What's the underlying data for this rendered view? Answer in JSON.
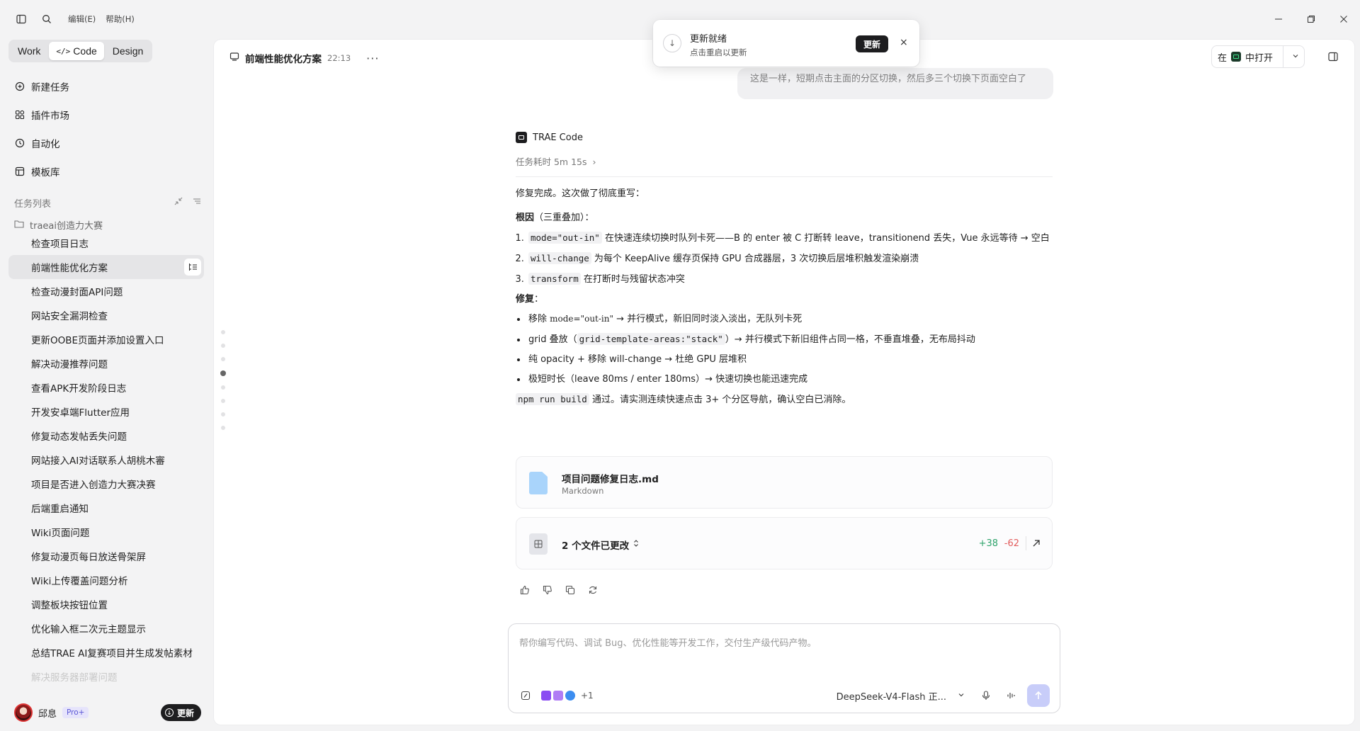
{
  "titlebar": {
    "menus": [
      "编辑(E)",
      "帮助(H)"
    ]
  },
  "sidebar": {
    "modes": [
      "Work",
      "Code",
      "Design"
    ],
    "active_mode": "Code",
    "nav": [
      {
        "label": "新建任务",
        "icon": "new-task-icon"
      },
      {
        "label": "插件市场",
        "icon": "plugin-market-icon"
      },
      {
        "label": "自动化",
        "icon": "automation-clock-icon"
      },
      {
        "label": "模板库",
        "icon": "template-icon"
      }
    ],
    "tasks_header": "任务列表",
    "folder": "traeai创造力大赛",
    "tasks": [
      "检查项目日志",
      "前端性能优化方案",
      "检查动漫封面API问题",
      "网站安全漏洞检查",
      "更新OOBE页面并添加设置入口",
      "解决动漫推荐问题",
      "查看APK开发阶段日志",
      "开发安卓端Flutter应用",
      "修复动态发帖丢失问题",
      "网站接入AI对话联系人胡桃木審",
      "项目是否进入创造力大赛决赛",
      "后端重启通知",
      "Wiki页面问题",
      "修复动漫页每日放送骨架屏",
      "Wiki上传覆盖问题分析",
      "调整板块按钮位置",
      "优化输入框二次元主题显示",
      "总结TRAE AI复赛项目并生成发帖素材",
      "解决服务器部署问题"
    ],
    "active_task_index": 1,
    "user": {
      "name": "邱息",
      "badge": "Pro+",
      "update_label": "更新"
    }
  },
  "header": {
    "title": "前端性能优化方案",
    "time": "22:13",
    "open_in_prefix": "在",
    "open_in_suffix": "中打开"
  },
  "toast": {
    "title": "更新就绪",
    "subtitle": "点击重启以更新",
    "button": "更新"
  },
  "message": {
    "prev_bubble": "这是一样，短期点击主面的分区切换，然后多三个切换下页面空白了",
    "agent": "TRAE Code",
    "duration": "任务耗时 5m 15s",
    "intro": "修复完成。这次做了彻底重写：",
    "cause_title_bold": "根因",
    "cause_title_rest": "（三重叠加）：",
    "causes": [
      {
        "code": "mode=\"out-in\"",
        "text": " 在快速连续切换时队列卡死——B 的 enter 被 C 打断转 leave，transitionend 丢失，Vue 永远等待 → 空白"
      },
      {
        "code": "will-change",
        "text": " 为每个 KeepAlive 缓存页保持 GPU 合成器层，3 次切换后层堆积触发渲染崩溃"
      },
      {
        "code": "transform",
        "text": " 在打断时与残留状态冲突"
      }
    ],
    "fix_title": "修复",
    "fix_colon": "：",
    "fixes": [
      {
        "pre": "移除 ",
        "code": "mode=\"out-in\"",
        "post": " → 并行模式，新旧同时淡入淡出，无队列卡死"
      },
      {
        "pre": "grid 叠放（",
        "code": "grid-template-areas:\"stack\"",
        "post": "）→ 并行模式下新旧组件占同一格，不垂直堆叠，无布局抖动"
      },
      {
        "pre": "纯 opacity + 移除 will-change → 杜绝 GPU 层堆积",
        "code": "",
        "post": ""
      },
      {
        "pre": "极短时长（leave 80ms / enter 180ms）→ 快速切换也能迅速完成",
        "code": "",
        "post": ""
      }
    ],
    "build_code": "npm run build",
    "build_text": " 通过。请实测连续快速点击 3+ 个分区导航，确认空白已消除。",
    "file": {
      "name": "项目问题修复日志.md",
      "type": "Markdown"
    },
    "changes": {
      "label": "2 个文件已更改",
      "added": "+38",
      "removed": "-62"
    }
  },
  "composer": {
    "placeholder": "帮你编写代码、调试 Bug、优化性能等开发工作，交付生产级代码产物。",
    "extra_count": "+1",
    "model": "DeepSeek-V4-Flash 正..."
  },
  "colors": {
    "added": "#2fa36b",
    "removed": "#e25c5c",
    "send_disabled": "#c8cdf9",
    "pro_badge": "#5b57d6"
  }
}
